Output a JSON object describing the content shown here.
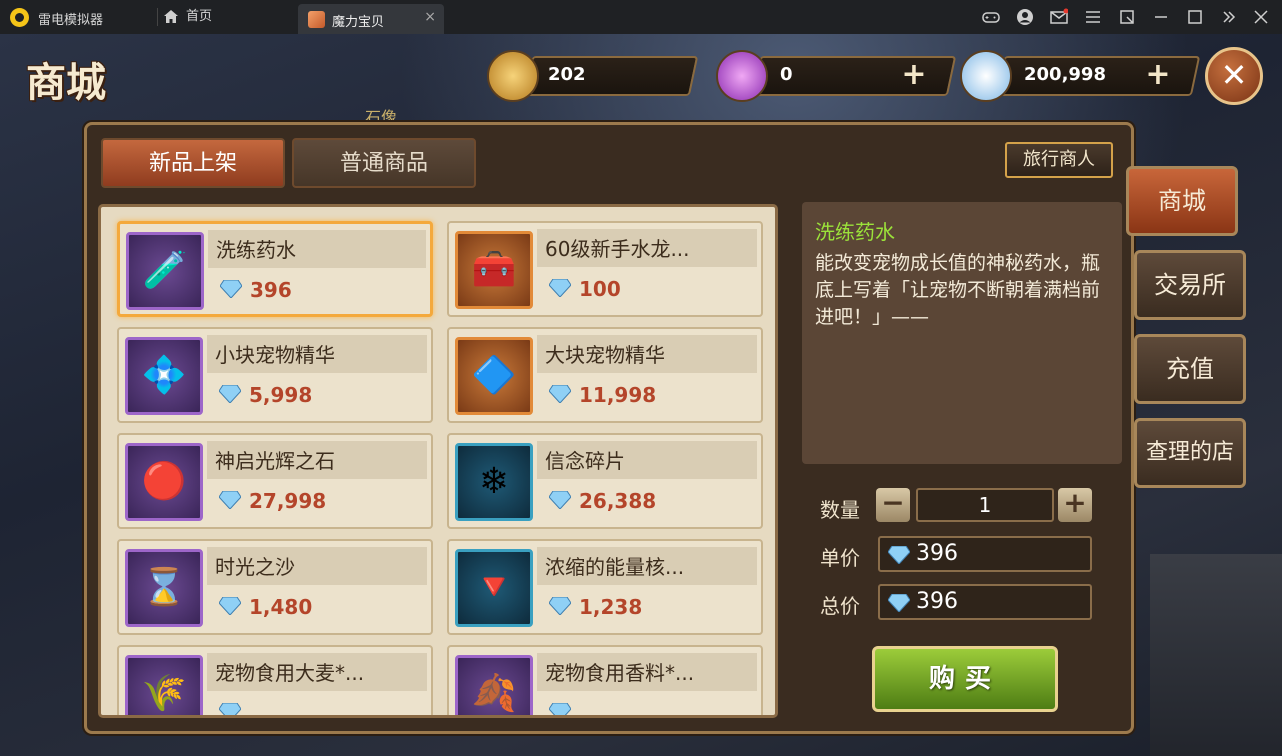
{
  "emulator": {
    "app_name": "雷电模拟器",
    "home_tab": "首页",
    "game_tab": "魔力宝贝",
    "close_tab": "×"
  },
  "game": {
    "title": "商城",
    "statue_label": "石像",
    "currencies": {
      "gold": "202",
      "crystal": "0",
      "diamond": "200,998",
      "plus": "+"
    },
    "close": "✕",
    "tabs": {
      "new": "新品上架",
      "normal": "普通商品"
    },
    "traveler_button": "旅行商人",
    "items": [
      {
        "name": "洗练药水",
        "price": "396",
        "icon": "potion-icon"
      },
      {
        "name": "60级新手水龙...",
        "price": "100",
        "icon": "chest-icon"
      },
      {
        "name": "小块宠物精华",
        "price": "5,998",
        "icon": "ore-icon"
      },
      {
        "name": "大块宠物精华",
        "price": "11,998",
        "icon": "sapphire-icon"
      },
      {
        "name": "神启光辉之石",
        "price": "27,998",
        "icon": "red-stone-icon"
      },
      {
        "name": "信念碎片",
        "price": "26,388",
        "icon": "crystal-shards-icon"
      },
      {
        "name": "时光之沙",
        "price": "1,480",
        "icon": "hourglass-icon"
      },
      {
        "name": "浓缩的能量核...",
        "price": "1,238",
        "icon": "energy-crystal-icon"
      },
      {
        "name": "宠物食用大麦*...",
        "price": "",
        "icon": "barley-icon"
      },
      {
        "name": "宠物食用香料*...",
        "price": "",
        "icon": "spice-icon"
      }
    ],
    "detail": {
      "name": "洗练药水",
      "description": "能改变宠物成长值的神秘药水，瓶底上写着「让宠物不断朝着满档前进吧！」——",
      "quantity_label": "数量",
      "quantity": "1",
      "minus": "−",
      "plus": "+",
      "unit_price_label": "单价",
      "unit_price": "396",
      "total_price_label": "总价",
      "total_price": "396",
      "buy": "购买"
    },
    "side_nav": [
      "商城",
      "交易所",
      "充值",
      "查理的店"
    ]
  }
}
